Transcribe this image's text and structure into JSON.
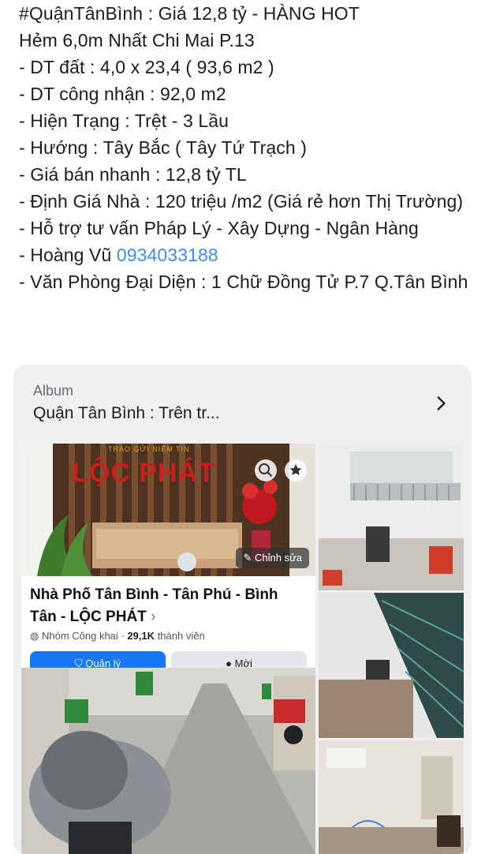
{
  "post": {
    "lines": [
      "#QuậnTânBình : Giá 12,8 tỷ - HÀNG HOT",
      "Hẻm 6,0m Nhất Chi Mai P.13",
      "- DT đất : 4,0 x 23,4 ( 93,6 m2 )",
      "- DT công nhận : 92,0 m2",
      "- Hiện Trạng : Trệt - 3 Lầu",
      "- Hướng : Tây Bắc ( Tây Tứ Trạch )",
      "- Giá bán nhanh : 12,8 tỷ TL",
      "- Định Giá Nhà : 120 triệu /m2 (Giá rẻ hơn Thị Trường)",
      "- Hỗ trợ tư vấn Pháp Lý - Xây Dựng - Ngân Hàng"
    ],
    "contact_prefix": "- Hoàng Vũ ",
    "contact_phone": "0934033188",
    "office": "- Văn Phòng Đại Diện : 1 Chữ Đồng Tử P.7 Q.Tân Bình"
  },
  "album": {
    "label": "Album",
    "title": "Quận Tân Bình : Trên tr...",
    "chevron_icon": "chevron-right-icon"
  },
  "group": {
    "name": "Nhà Phố Tân Bình - Tân Phú - Bình Tân - LỘC PHÁT",
    "visibility": "Nhóm Công khai",
    "members_count": "29,1K",
    "members_label": "thành viên",
    "manage_label": "Quản lý",
    "more_label": "Mời",
    "edit_label": "Chỉnh sửa",
    "logo_text": "LỘC PHÁT",
    "logo_sub": "TRAO GỬI NIỀM TIN"
  },
  "colors": {
    "link": "#3d8ee8",
    "card_bg": "#f0f0f2",
    "primary_button": "#1877f2"
  }
}
